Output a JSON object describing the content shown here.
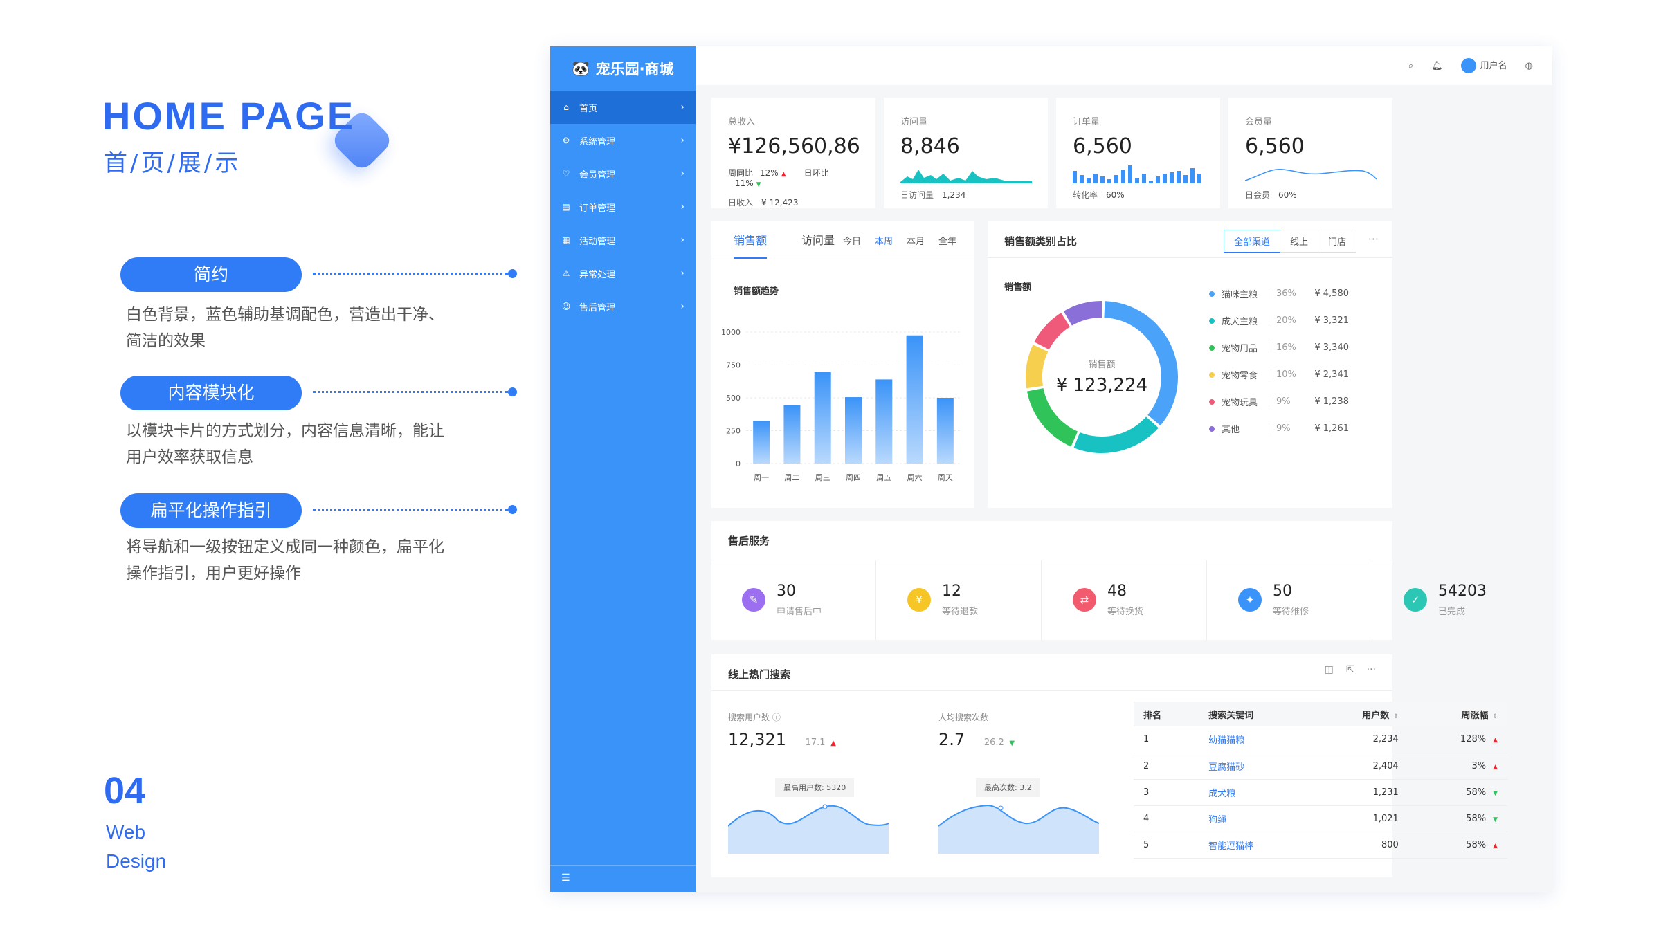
{
  "intro": {
    "title": "HOME PAGE",
    "subtitle": "首/页/展/示",
    "features": [
      {
        "label": "简约",
        "desc": "白色背景，蓝色辅助基调配色，营造出干净、简洁的效果"
      },
      {
        "label": "内容模块化",
        "desc": "以模块卡片的方式划分，内容信息清晰，能让用户效率获取信息"
      },
      {
        "label": "扁平化操作指引",
        "desc": "将导航和一级按钮定义成同一种颜色，扁平化操作指引，用户更好操作"
      }
    ],
    "number": "04",
    "web": "Web",
    "design": "Design"
  },
  "sidebar": {
    "brand": "宠乐园·商城",
    "items": [
      {
        "label": "首页",
        "icon": "home-icon",
        "glyph": "⌂"
      },
      {
        "label": "系统管理",
        "icon": "settings-icon",
        "glyph": "⚙"
      },
      {
        "label": "会员管理",
        "icon": "member-icon",
        "glyph": "♡"
      },
      {
        "label": "订单管理",
        "icon": "order-icon",
        "glyph": "▤"
      },
      {
        "label": "活动管理",
        "icon": "activity-icon",
        "glyph": "▦"
      },
      {
        "label": "异常处理",
        "icon": "warning-icon",
        "glyph": "⚠"
      },
      {
        "label": "售后管理",
        "icon": "service-icon",
        "glyph": "☺"
      }
    ]
  },
  "header": {
    "username": "用户名"
  },
  "metrics": [
    {
      "label": "总收入",
      "value": "¥126,560,86",
      "l1a": "周同比",
      "l1b": "12%",
      "l1c": "日环比",
      "l1d": "11%",
      "l2a": "日收入",
      "l2b": "¥ 12,423"
    },
    {
      "label": "访问量",
      "value": "8,846",
      "l2a": "日访问量",
      "l2b": "1,234"
    },
    {
      "label": "订单量",
      "value": "6,560",
      "l2a": "转化率",
      "l2b": "60%"
    },
    {
      "label": "会员量",
      "value": "6,560",
      "l2a": "日会员",
      "l2b": "60%"
    }
  ],
  "sales": {
    "tab1": "销售额",
    "tab2": "访问量",
    "ranges": [
      "今日",
      "本周",
      "本月",
      "全年"
    ],
    "selected_range": "本周"
  },
  "chart_data": [
    {
      "type": "bar",
      "title": "销售额趋势",
      "categories": [
        "周一",
        "周二",
        "周三",
        "周四",
        "周五",
        "周六",
        "周天"
      ],
      "values": [
        325,
        445,
        695,
        505,
        640,
        975,
        500
      ],
      "ylim": [
        0,
        1000
      ],
      "yticks": [
        0,
        250,
        500,
        750,
        1000
      ]
    },
    {
      "type": "pie",
      "title": "销售额",
      "center_label": "销售额",
      "center_value": "¥ 123,224",
      "slices": [
        {
          "name": "猫咪主粮",
          "pct": "36%",
          "amount": "¥ 4,580",
          "value": 36,
          "color": "#4aa3f8"
        },
        {
          "name": "成犬主粮",
          "pct": "20%",
          "amount": "¥ 3,321",
          "value": 20,
          "color": "#19c2c2"
        },
        {
          "name": "宠物用品",
          "pct": "16%",
          "amount": "¥ 3,340",
          "value": 16,
          "color": "#2fc35a"
        },
        {
          "name": "宠物零食",
          "pct": "10%",
          "amount": "¥ 2,341",
          "value": 10,
          "color": "#f7cf4f"
        },
        {
          "name": "宠物玩具",
          "pct": "9%",
          "amount": "¥ 1,238",
          "value": 9,
          "color": "#f05a7a"
        },
        {
          "name": "其他",
          "pct": "9%",
          "amount": "¥ 1,261",
          "value": 9,
          "color": "#8a6fd8"
        }
      ]
    }
  ],
  "category": {
    "title": "销售额类别占比",
    "buttons": [
      "全部渠道",
      "线上",
      "门店"
    ]
  },
  "aftersale": {
    "title": "售后服务",
    "items": [
      {
        "value": "30",
        "label": "申请售后中",
        "color": "#9b6ff0",
        "icon": "apply-icon",
        "glyph": "✎"
      },
      {
        "value": "12",
        "label": "等待退款",
        "color": "#f5c626",
        "icon": "refund-icon",
        "glyph": "¥"
      },
      {
        "value": "48",
        "label": "等待换货",
        "color": "#f25a6e",
        "icon": "exchange-icon",
        "glyph": "⇄"
      },
      {
        "value": "50",
        "label": "等待维修",
        "color": "#3a93f8",
        "icon": "repair-icon",
        "glyph": "✦"
      },
      {
        "value": "54203",
        "label": "已完成",
        "color": "#2cc7b4",
        "icon": "done-icon",
        "glyph": "✓"
      }
    ]
  },
  "hot": {
    "title": "线上热门搜索",
    "users_label": "搜索用户数",
    "users_value": "12,321",
    "users_change": "17.1",
    "users_tip": "最高用户数: 5320",
    "avg_label": "人均搜索次数",
    "avg_value": "2.7",
    "avg_change": "26.2",
    "avg_tip": "最高次数: 3.2",
    "columns": [
      "排名",
      "搜索关键词",
      "用户数",
      "周涨幅"
    ],
    "rows": [
      {
        "rank": "1",
        "kw": "幼猫猫粮",
        "users": "2,234",
        "chg": "128%",
        "up": true
      },
      {
        "rank": "2",
        "kw": "豆腐猫砂",
        "users": "2,404",
        "chg": "3%",
        "up": true
      },
      {
        "rank": "3",
        "kw": "成犬粮",
        "users": "1,231",
        "chg": "58%",
        "up": false
      },
      {
        "rank": "4",
        "kw": "狗绳",
        "users": "1,021",
        "chg": "58%",
        "up": false
      },
      {
        "rank": "5",
        "kw": "智能逗猫棒",
        "users": "800",
        "chg": "58%",
        "up": true
      }
    ]
  },
  "colors": {
    "accent": "#2f7cf6",
    "sidebar": "#3a93f8",
    "up": "#f5222d",
    "down": "#2fc35a"
  }
}
